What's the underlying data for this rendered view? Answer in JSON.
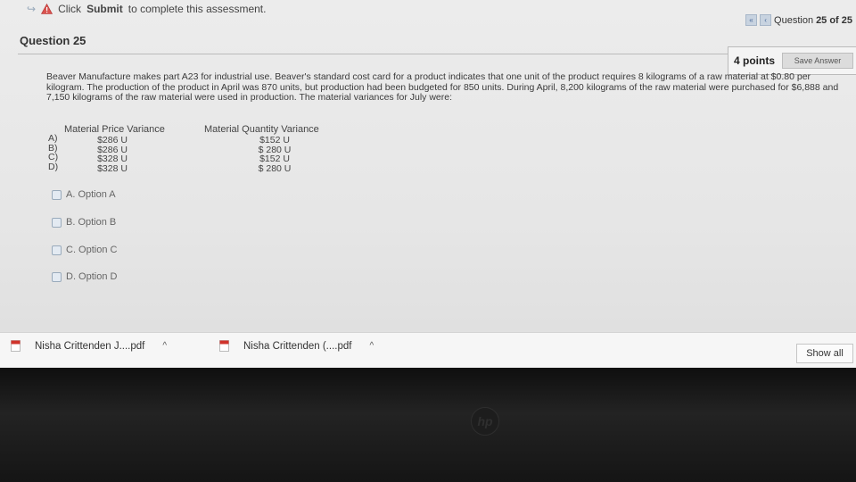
{
  "header": {
    "instruction_prefix": "Click",
    "instruction_bold": "Submit",
    "instruction_suffix": "to complete this assessment.",
    "question_counter_label": "Question",
    "question_number": "25",
    "question_of": "of 25"
  },
  "question": {
    "title": "Question 25",
    "points": "4 points",
    "save_label": "Save Answer",
    "text": "Beaver Manufacture makes part A23 for industrial use. Beaver's standard cost card for a product indicates that one unit of the product requires 8 kilograms of a raw material at $0.80 per kilogram. The production of the product in April was 870 units, but production had been budgeted for 850 units. During April, 8,200 kilograms of the raw material were purchased for $6,888 and 7,150 kilograms of the raw material were used in production. The material variances for July were:",
    "table": {
      "price_header": "Material Price Variance",
      "quantity_header": "Material Quantity Variance",
      "rows": [
        {
          "letter": "A)",
          "price": "$286 U",
          "quantity": "$152 U"
        },
        {
          "letter": "B)",
          "price": "$286 U",
          "quantity": "$ 280 U"
        },
        {
          "letter": "C)",
          "price": "$328 U",
          "quantity": "$152 U"
        },
        {
          "letter": "D)",
          "price": "$328 U",
          "quantity": "$ 280 U"
        }
      ]
    },
    "options": [
      "A. Option A",
      "B. Option B",
      "C. Option C",
      "D. Option D"
    ]
  },
  "downloads": {
    "items": [
      {
        "name": "Nisha Crittenden J....pdf"
      },
      {
        "name": "Nisha Crittenden (....pdf"
      }
    ],
    "show_all_label": "Show all"
  },
  "colors": {
    "warning": "#d9534f",
    "pdf_red": "#d0342c"
  }
}
